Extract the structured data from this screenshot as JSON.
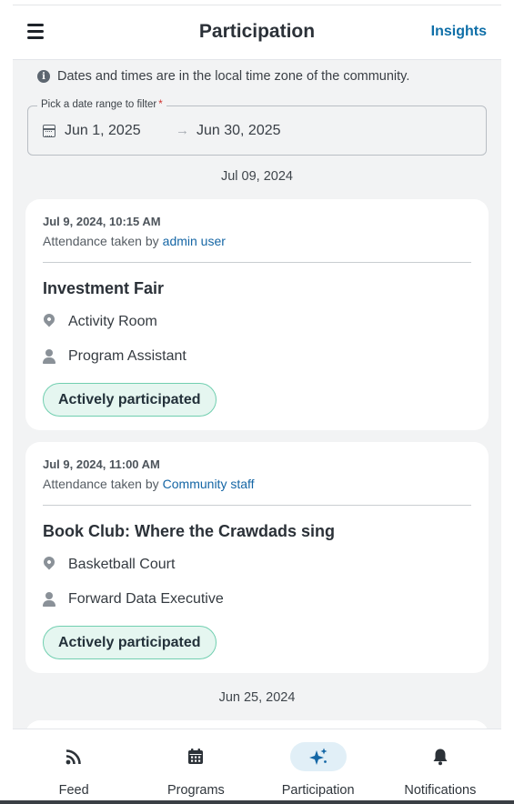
{
  "header": {
    "title": "Participation",
    "insights_label": "Insights"
  },
  "notice": {
    "text": "Dates and times are in the local time zone of the community."
  },
  "date_filter": {
    "label": "Pick a date range to filter",
    "required_mark": "*",
    "start": "Jun 1, 2025",
    "separator": "→",
    "end": "Jun 30, 2025"
  },
  "groups": [
    {
      "date": "Jul 09, 2024",
      "records": [
        {
          "timestamp": "Jul 9, 2024, 10:15 AM",
          "taken_by_prefix": "Attendance taken by",
          "taken_by": "admin user",
          "event": "Investment Fair",
          "location": "Activity Room",
          "staff": "Program Assistant",
          "status": "Actively participated"
        },
        {
          "timestamp": "Jul 9, 2024, 11:00 AM",
          "taken_by_prefix": "Attendance taken by",
          "taken_by": "Community staff",
          "event": "Book Club: Where the Crawdads sing",
          "location": "Basketball Court",
          "staff": "Forward Data Executive",
          "status": "Actively participated"
        }
      ]
    },
    {
      "date": "Jun 25, 2024",
      "records": []
    }
  ],
  "bottom_nav": [
    {
      "label": "Feed",
      "icon": "rss-icon",
      "active": false
    },
    {
      "label": "Programs",
      "icon": "calendar-icon",
      "active": false
    },
    {
      "label": "Participation",
      "icon": "sparkle-icon",
      "active": true
    },
    {
      "label": "Notifications",
      "icon": "bell-icon",
      "active": false
    }
  ],
  "colors": {
    "accent": "#0f6fa8",
    "badge_bg": "#e5f6f0",
    "badge_border": "#71cfb0",
    "background": "#f2f3f4"
  }
}
